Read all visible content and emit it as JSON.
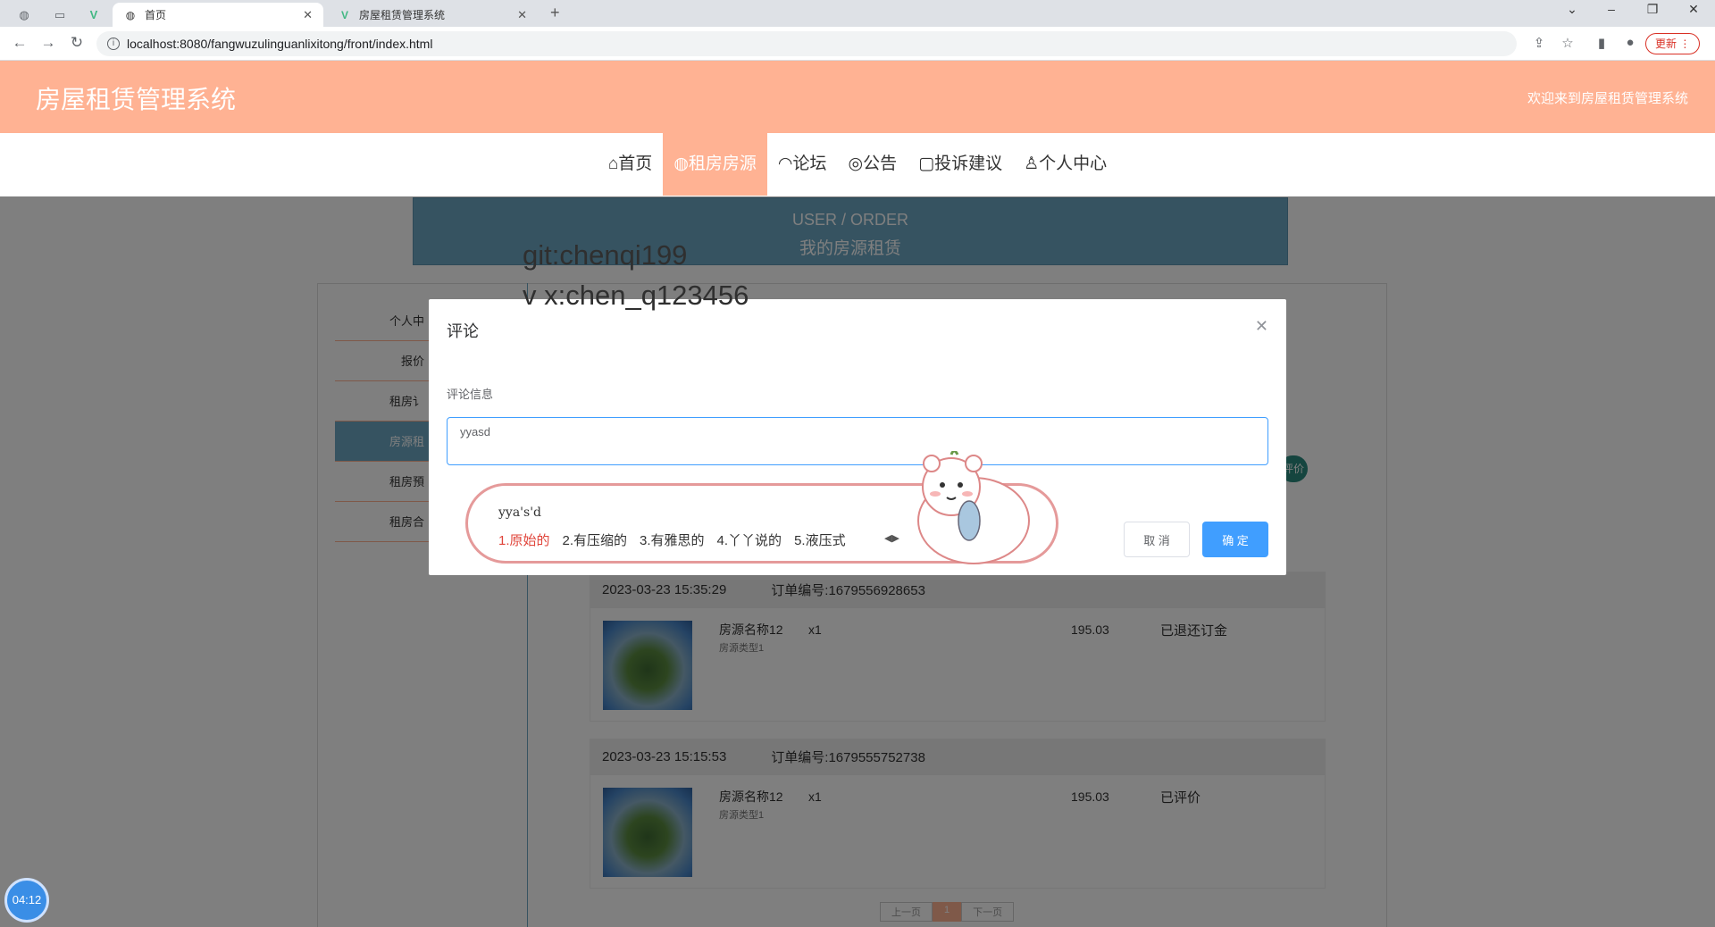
{
  "browser": {
    "tabs": [
      {
        "title": "首页",
        "active": true
      },
      {
        "title": "房屋租赁管理系统",
        "active": false
      }
    ],
    "url": "localhost:8080/fangwuzulinguanlixitong/front/index.html",
    "update_label": "更新"
  },
  "site": {
    "title": "房屋租赁管理系统",
    "welcome": "欢迎来到房屋租赁管理系统",
    "nav": [
      "首页",
      "租房房源",
      "论坛",
      "公告",
      "投诉建议",
      "个人中心"
    ],
    "nav_active": "租房房源"
  },
  "breadcrumb": {
    "en": "USER / ORDER",
    "cn": "我的房源租赁"
  },
  "sidebar": {
    "items": [
      {
        "label": "个人中"
      },
      {
        "label": "报价"
      },
      {
        "label": "租房讠"
      },
      {
        "label": "房源租"
      },
      {
        "label": "租房預"
      },
      {
        "label": "租房合"
      }
    ],
    "active_index": 3
  },
  "orders": [
    {
      "date": "2023-03-23 15:35:29",
      "order_no": "订单编号:1679556928653",
      "name": "房源名称12",
      "type": "房源类型1",
      "qty": "x1",
      "price": "195.03",
      "status": "已退还订金"
    },
    {
      "date": "2023-03-23 15:15:53",
      "order_no": "订单编号:1679555752738",
      "name": "房源名称12",
      "type": "房源类型1",
      "qty": "x1",
      "price": "195.03",
      "status": "已评价"
    }
  ],
  "badge_label": "评价",
  "pager": {
    "prev": "上一页",
    "current": "1",
    "next": "下一页"
  },
  "dialog": {
    "title": "评论",
    "field_label": "评论信息",
    "textarea_value": "yyasd",
    "cancel_label": "取 消",
    "ok_label": "确 定"
  },
  "ime": {
    "composition": "yya's'd",
    "candidates": [
      "1.原始的",
      "2.有压缩的",
      "3.有雅思的",
      "4.丫丫说的",
      "5.液压式"
    ]
  },
  "watermark": [
    "git:chenqi199",
    "v x:chen_q123456"
  ],
  "timer": "04:12"
}
